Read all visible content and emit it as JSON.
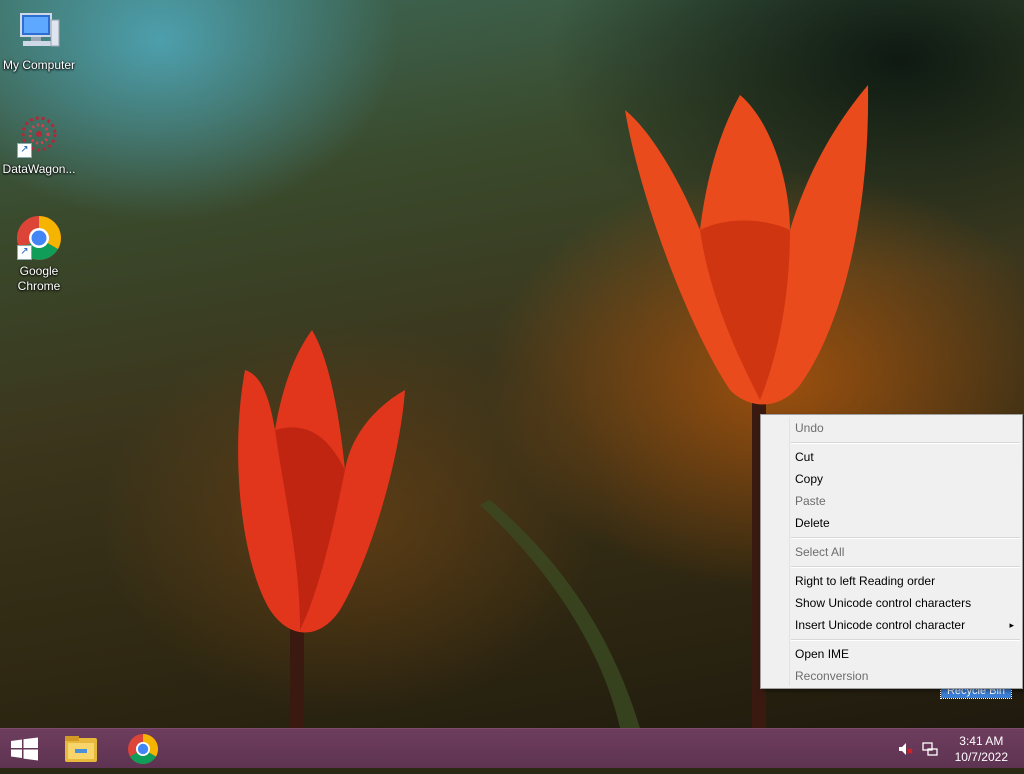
{
  "desktop": {
    "icons": [
      {
        "label": "My Computer",
        "icon": "computer-icon"
      },
      {
        "label": "DataWagon...",
        "icon": "datawagon-icon"
      },
      {
        "label": "Google Chrome",
        "icon": "chrome-icon"
      }
    ],
    "recycle_bin_label": "Recycle Bin"
  },
  "context_menu": {
    "items": [
      {
        "label": "Undo",
        "enabled": false
      },
      {
        "label": "Cut",
        "enabled": true
      },
      {
        "label": "Copy",
        "enabled": true
      },
      {
        "label": "Paste",
        "enabled": false
      },
      {
        "label": "Delete",
        "enabled": true
      },
      {
        "label": "Select All",
        "enabled": false
      },
      {
        "label": "Right to left Reading order",
        "enabled": true
      },
      {
        "label": "Show Unicode control characters",
        "enabled": true
      },
      {
        "label": "Insert Unicode control character",
        "enabled": true,
        "submenu": true
      },
      {
        "label": "Open IME",
        "enabled": true
      },
      {
        "label": "Reconversion",
        "enabled": false
      }
    ],
    "submenu_arrow": "▸"
  },
  "taskbar": {
    "start_icon": "windows-start-icon",
    "pinned": [
      "file-explorer-icon",
      "chrome-icon"
    ],
    "tray": [
      "speaker-muted-icon",
      "network-icon"
    ],
    "clock": {
      "time": "3:41 AM",
      "date": "10/7/2022"
    }
  },
  "colors": {
    "taskbar": "#5e3352",
    "menu_bg": "#f0f0f0",
    "selection": "#3c7fd6"
  }
}
